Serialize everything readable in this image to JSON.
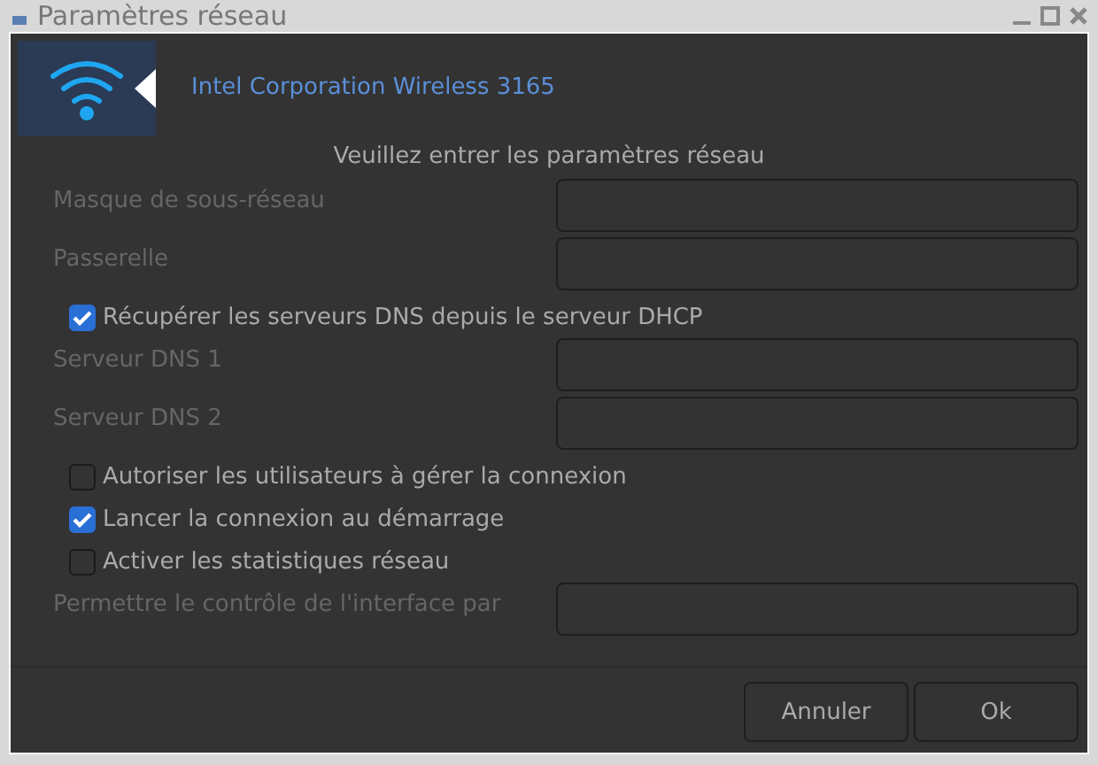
{
  "window": {
    "title": "Paramètres réseau"
  },
  "header": {
    "device": "Intel Corporation Wireless 3165"
  },
  "subtitle": "Veuillez entrer les paramètres réseau",
  "rows": [
    {
      "kind": "field",
      "label": "Masque de sous-réseau"
    },
    {
      "kind": "field",
      "label": "Passerelle"
    },
    {
      "kind": "checkbox",
      "label": "Récupérer les serveurs DNS depuis le serveur DHCP",
      "checked": true
    },
    {
      "kind": "field",
      "label": "Serveur DNS 1"
    },
    {
      "kind": "field",
      "label": "Serveur DNS 2"
    },
    {
      "kind": "checkbox",
      "label": "Autoriser les utilisateurs à gérer la connexion",
      "checked": false
    },
    {
      "kind": "checkbox",
      "label": "Lancer la connexion au démarrage",
      "checked": true
    },
    {
      "kind": "checkbox",
      "label": "Activer les statistiques réseau",
      "checked": false
    },
    {
      "kind": "field",
      "label": "Permettre le contrôle de l'interface par"
    }
  ],
  "buttons": [
    "Annuler",
    "Ok"
  ]
}
